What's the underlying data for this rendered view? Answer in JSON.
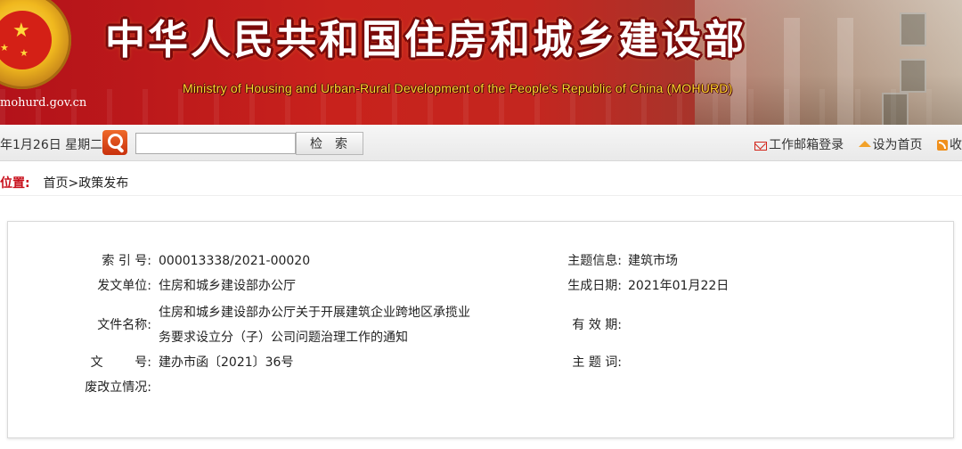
{
  "header": {
    "title_cn": "中华人民共和国住房和城乡建设部",
    "title_en": "Ministry of Housing and Urban-Rural Development of the People's Republic of China (MOHURD)",
    "site_url": "mohurd.gov.cn",
    "colors": {
      "banner_red": "#c8221c",
      "english_gold": "#ffd62c"
    }
  },
  "toolbar": {
    "date": "年1月26日 星期二",
    "search_placeholder": "",
    "search_button": "检索",
    "links": [
      {
        "label": "工作邮箱登录",
        "icon": "mail-icon"
      },
      {
        "label": "设为首页",
        "icon": "home-icon"
      },
      {
        "label": "收",
        "icon": "rss-icon"
      }
    ]
  },
  "breadcrumb": {
    "label": "位置:",
    "items": [
      "首页",
      "政策发布"
    ],
    "separator": ">",
    "label_color": "#c8101c"
  },
  "info": {
    "index_no_label": "索 引 号:",
    "index_no": "000013338/2021-00020",
    "topic_label": "主题信息:",
    "topic": "建筑市场",
    "issuer_label": "发文单位:",
    "issuer": "住房和城乡建设部办公厅",
    "date_label": "生成日期:",
    "date": "2021年01月22日",
    "filename_label": "文件名称:",
    "filename_line1": "住房和城乡建设部办公厅关于开展建筑企业跨地区承揽业",
    "filename_line2": "务要求设立分（子）公司问题治理工作的通知",
    "validity_label": "有 效 期:",
    "doc_no_label": "文        号:",
    "doc_no": "建办市函〔2021〕36号",
    "keywords_label": "主 题 词:",
    "status_label": "废改立情况:"
  }
}
